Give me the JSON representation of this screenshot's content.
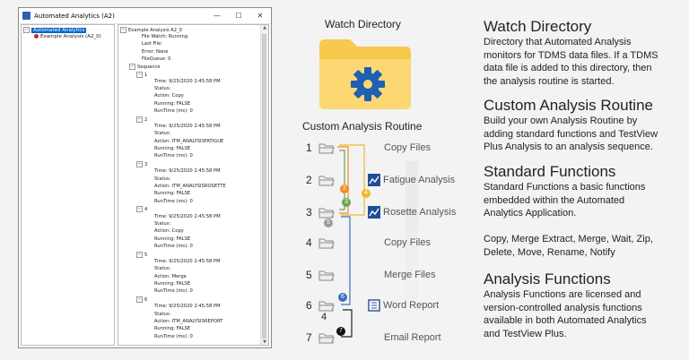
{
  "window": {
    "title": "Automated Analytics (A2)",
    "controls": {
      "minimize": "—",
      "maximize": "☐",
      "close": "✕"
    }
  },
  "left_tree": {
    "root": "Automated Analytics",
    "child": "Example Analysis (A2_0)"
  },
  "details": {
    "root": "Example Analysis A2_0",
    "fields": [
      "File Watch: Running",
      "Last File:",
      "Error: None",
      "FileQueue: 0"
    ],
    "sequence_label": "Sequence",
    "steps": [
      {
        "num": "1",
        "lines": [
          "Time: 9/25/2020 2:45:58 PM",
          "Status:",
          "Action: Copy",
          "Running: FALSE",
          "RunTime (ms): 0"
        ]
      },
      {
        "num": "2",
        "lines": [
          "Time: 9/25/2020 2:45:58 PM",
          "Status:",
          "Action: ITM_ANALYSISFATIGUE",
          "Running: FALSE",
          "RunTime (ms): 0"
        ]
      },
      {
        "num": "3",
        "lines": [
          "Time: 9/25/2020 2:45:58 PM",
          "Status:",
          "Action: ITM_ANALYSISROSETTE",
          "Running: FALSE",
          "RunTime (ms): 0"
        ]
      },
      {
        "num": "4",
        "lines": [
          "Time: 9/25/2020 2:45:58 PM",
          "Status:",
          "Action: Copy",
          "Running: FALSE",
          "RunTime (ms): 0"
        ]
      },
      {
        "num": "5",
        "lines": [
          "Time: 9/25/2020 2:45:58 PM",
          "Status:",
          "Action: Merge",
          "Running: FALSE",
          "RunTime (ms): 0"
        ]
      },
      {
        "num": "6",
        "lines": [
          "Time: 9/25/2020 2:45:58 PM",
          "Status:",
          "Action: ITM_ANALYSISREPORT",
          "Running: FALSE",
          "RunTime (ms): 0"
        ]
      }
    ]
  },
  "diagram": {
    "watch_title": "Watch Directory",
    "routine_title": "Custom Analysis Routine",
    "steps": [
      {
        "num": "1",
        "name": "Copy Files"
      },
      {
        "num": "2",
        "name": "Fatigue Analysis"
      },
      {
        "num": "3",
        "name": "Rosette Analysis"
      },
      {
        "num": "4",
        "name": "Copy Files"
      },
      {
        "num": "5",
        "name": "Merge Files"
      },
      {
        "num": "6",
        "name": "Word Report"
      },
      {
        "num": "7",
        "name": "Email Report"
      }
    ],
    "badges": [
      "1",
      "2",
      "3",
      "4",
      "5",
      "6",
      "7"
    ],
    "extra_label": "4",
    "colors": {
      "folder": "#f7c94c",
      "gear": "#1f5fb4",
      "orange": "#f28c28",
      "green": "#6aa84f",
      "yellow": "#f1b82d",
      "blue": "#3a6fc1"
    }
  },
  "descriptions": [
    {
      "title": "Watch Directory",
      "body": [
        "Directory that Automated Analysis",
        "monitors for TDMS data files.  If a TDMS",
        "data file is added to this directory, then",
        "the analysis routine is started."
      ]
    },
    {
      "title": "Custom Analysis Routine",
      "body": [
        "Build your own Analysis Routine by",
        "adding standard functions and TestView",
        "Plus Analysis to an analysis sequence."
      ]
    },
    {
      "title": "Standard Functions",
      "body": [
        "Standard Functions a basic functions",
        "embedded within the Automated",
        "Analytics Application.",
        "",
        "Copy, Merge Extract, Merge, Wait, Zip,",
        "Delete, Move, Rename, Notify"
      ]
    },
    {
      "title": "Analysis Functions",
      "body": [
        "Analysis Functions are licensed and",
        "version-controlled analysis functions",
        "available in both Automated Analytics",
        "and TestView Plus."
      ]
    }
  ]
}
